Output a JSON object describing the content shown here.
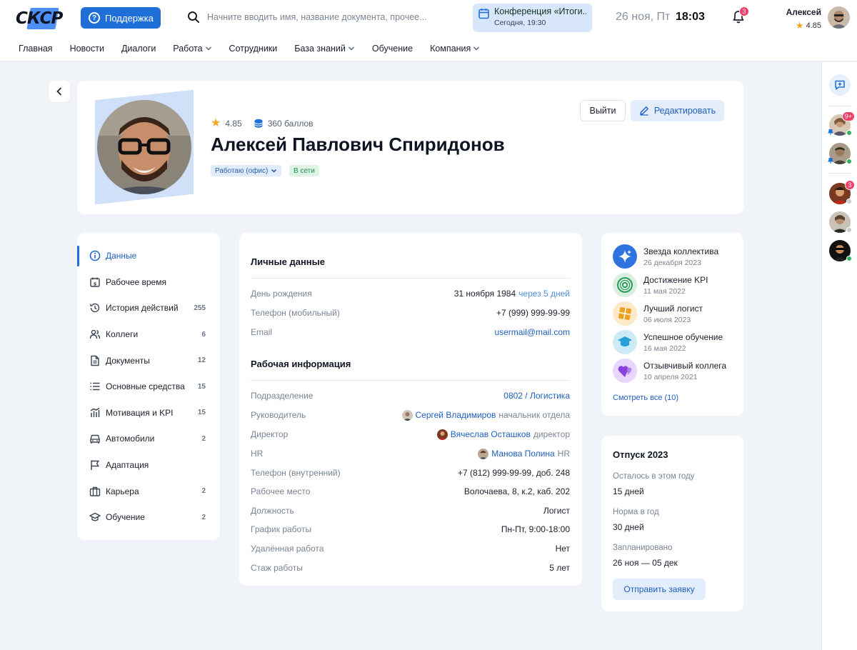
{
  "header": {
    "logo_text": "СКСР",
    "support_label": "Поддержка",
    "search_placeholder": "Начните вводить имя, название документа, прочее...",
    "event_title": "Конференция «Итоги...",
    "event_time": "Сегодня, 19:30",
    "date": "26 ноя, Пт",
    "time": "18:03",
    "notifications_count": "3",
    "user_name": "Алексей",
    "user_rating": "4.85"
  },
  "nav": [
    {
      "label": "Главная",
      "has_dropdown": false
    },
    {
      "label": "Новости",
      "has_dropdown": false
    },
    {
      "label": "Диалоги",
      "has_dropdown": false
    },
    {
      "label": "Работа",
      "has_dropdown": true
    },
    {
      "label": "Сотрудники",
      "has_dropdown": false
    },
    {
      "label": "База знаний",
      "has_dropdown": true
    },
    {
      "label": "Обучение",
      "has_dropdown": false
    },
    {
      "label": "Компания",
      "has_dropdown": true
    }
  ],
  "rail": {
    "badge_1": "9+",
    "badge_3": "3"
  },
  "profile": {
    "rating": "4.85",
    "points": "360 баллов",
    "full_name": "Алексей Павлович Спиридонов",
    "work_status": "Работаю (офис)",
    "online_status": "В сети",
    "logout_label": "Выйти",
    "edit_label": "Редактировать"
  },
  "menu": [
    {
      "label": "Данные",
      "count": "",
      "icon": "info-icon",
      "active": true
    },
    {
      "label": "Рабочее время",
      "count": "",
      "icon": "calendar-money-icon",
      "active": false
    },
    {
      "label": "История действий",
      "count": "255",
      "icon": "history-icon",
      "active": false
    },
    {
      "label": "Коллеги",
      "count": "6",
      "icon": "users-icon",
      "active": false
    },
    {
      "label": "Документы",
      "count": "12",
      "icon": "document-icon",
      "active": false
    },
    {
      "label": "Основные средства",
      "count": "15",
      "icon": "list-icon",
      "active": false
    },
    {
      "label": "Мотивация и KPI",
      "count": "15",
      "icon": "chart-icon",
      "active": false
    },
    {
      "label": "Автомобили",
      "count": "2",
      "icon": "car-icon",
      "active": false
    },
    {
      "label": "Адаптация",
      "count": "",
      "icon": "flag-icon",
      "active": false
    },
    {
      "label": "Карьера",
      "count": "2",
      "icon": "briefcase-icon",
      "active": false
    },
    {
      "label": "Обучение",
      "count": "2",
      "icon": "graduation-icon",
      "active": false
    }
  ],
  "personal": {
    "title": "Личные данные",
    "birthday_label": "День рождения",
    "birthday_value": "31 ноября 1984",
    "birthday_hint": "через 5 дней",
    "phone_label": "Телефон (мобильный)",
    "phone_value": "+7 (999) 999-99-99",
    "email_label": "Email",
    "email_value": "usermail@mail.com"
  },
  "work": {
    "title": "Рабочая информация",
    "department_label": "Подразделение",
    "department_value": "0802 / Логистика",
    "manager_label": "Руководитель",
    "manager_name": "Сергей Владимиров",
    "manager_role": "начальник отдела",
    "director_label": "Директор",
    "director_name": "Вячеслав Осташков",
    "director_role": "директор",
    "hr_label": "HR",
    "hr_name": "Манова Полина",
    "hr_role": "HR",
    "inner_phone_label": "Телефон (внутренний)",
    "inner_phone_value": "+7 (812) 999-99-99, доб. 248",
    "workplace_label": "Рабочее место",
    "workplace_value": "Волочаева, 8, к.2, каб. 202",
    "position_label": "Должность",
    "position_value": "Логист",
    "schedule_label": "График работы",
    "schedule_value": "Пн-Пт, 9:00-18:00",
    "remote_label": "Удалённая работа",
    "remote_value": "Нет",
    "tenure_label": "Стаж работы",
    "tenure_value": "5 лет"
  },
  "achievements": {
    "items": [
      {
        "name": "Звезда коллектива",
        "date": "26 декабря 2023",
        "icon": "sparkle-icon",
        "color": "#2f73e0"
      },
      {
        "name": "Достижение KPI",
        "date": "11 мая 2022",
        "icon": "target-icon",
        "color": "#2aa05a"
      },
      {
        "name": "Лучший логист",
        "date": "06 июля 2023",
        "icon": "box-icon",
        "color": "#f0a020"
      },
      {
        "name": "Успешное обучение",
        "date": "16 мая 2022",
        "icon": "graduation-icon",
        "color": "#26a0d8"
      },
      {
        "name": "Отзывчивый коллега",
        "date": "10 апреля 2021",
        "icon": "hearts-icon",
        "color": "#8a3fe0"
      }
    ],
    "see_all": "Смотреть все (10)"
  },
  "vacation": {
    "title": "Отпуск 2023",
    "left_label": "Осталось в этом году",
    "left_value": "15 дней",
    "norm_label": "Норма в год",
    "norm_value": "30 дней",
    "planned_label": "Запланировано",
    "planned_value": "26 ноя — 05 дек",
    "request_label": "Отправить заявку"
  }
}
